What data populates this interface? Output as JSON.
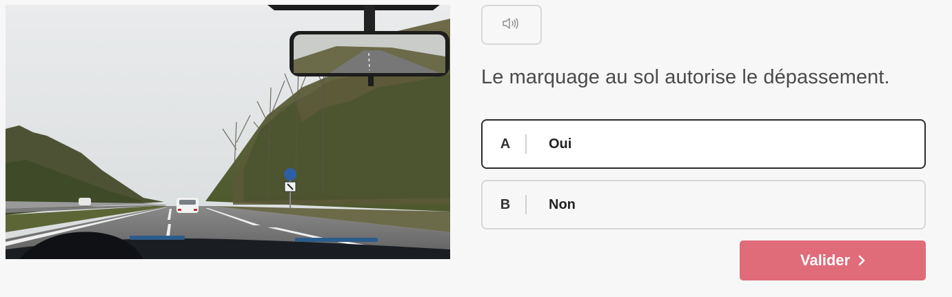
{
  "question": {
    "text": "Le marquage au sol autorise le dépassement."
  },
  "audio_button": {
    "icon": "speaker-icon"
  },
  "answers": [
    {
      "letter": "A",
      "label": "Oui",
      "selected": true
    },
    {
      "letter": "B",
      "label": "Non",
      "selected": false
    }
  ],
  "actions": {
    "validate_label": "Valider",
    "validate_icon": "chevron-right-icon"
  },
  "colors": {
    "accent": "#e06b79",
    "background": "#f7f7f7",
    "selected_border": "#2b2b2b"
  }
}
